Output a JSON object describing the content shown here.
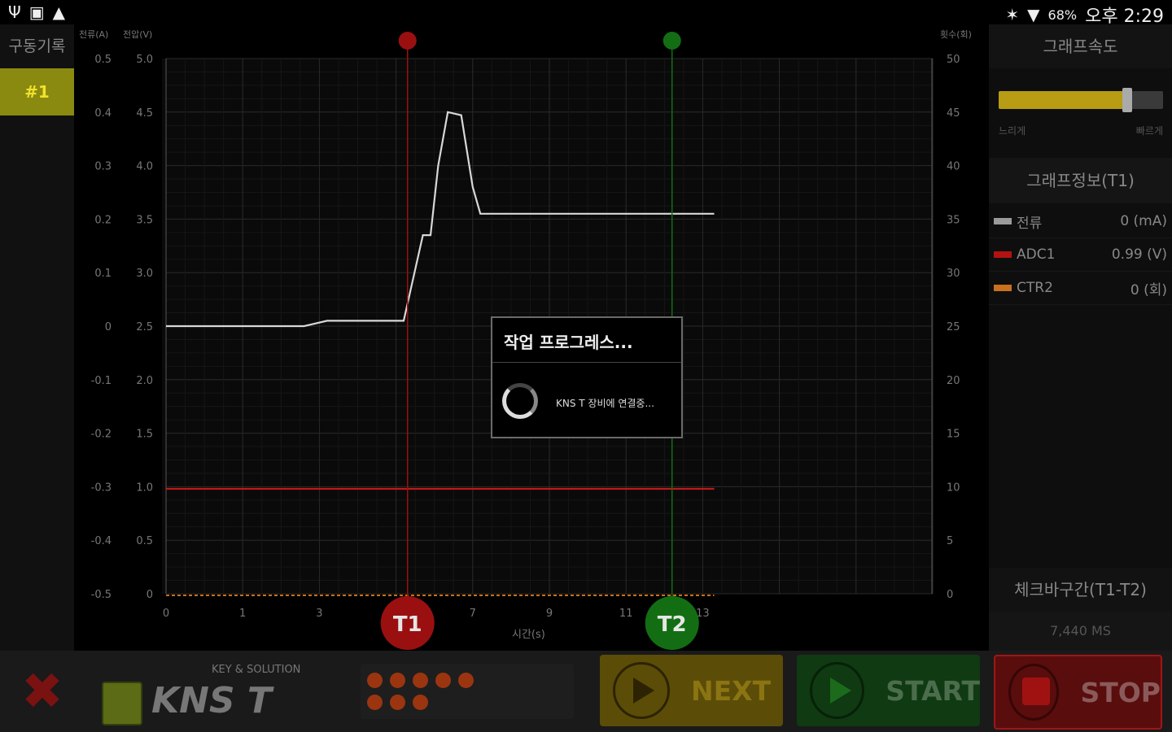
{
  "status_bar": {
    "icons_left": [
      "usb-icon",
      "image-icon",
      "warning-icon"
    ],
    "icons_right": [
      "bluetooth-icon",
      "wifi-icon"
    ],
    "battery": "68%",
    "time": "오후 2:29"
  },
  "left_panel": {
    "title": "구동기록",
    "items": [
      {
        "label": "#1"
      }
    ]
  },
  "chart_data": {
    "type": "line",
    "axis_titles": {
      "left1": "전류(A)",
      "left2": "전압(V)",
      "right": "횟수(회)",
      "x": "시간(s)"
    },
    "x_ticks": [
      "0",
      "1",
      "3",
      "5",
      "7",
      "9",
      "11",
      "13"
    ],
    "y_left1_ticks": [
      "0.5",
      "0.4",
      "0.3",
      "0.2",
      "0.1",
      "0",
      "-0.1",
      "-0.2",
      "-0.3",
      "-0.4",
      "-0.5"
    ],
    "y_left2_ticks": [
      "5.0",
      "4.5",
      "4.0",
      "3.5",
      "3.0",
      "2.5",
      "2.0",
      "1.5",
      "1.0",
      "0.5",
      "0"
    ],
    "y_right_ticks": [
      "50",
      "45",
      "40",
      "35",
      "30",
      "25",
      "20",
      "15",
      "10",
      "5",
      "0"
    ],
    "voltage_ylim": [
      0,
      5.0
    ],
    "series": [
      {
        "name": "ADC1",
        "color": "#d8d8d8",
        "axis": "voltage",
        "points": [
          [
            0,
            2.5
          ],
          [
            3.6,
            2.5
          ],
          [
            4.2,
            2.55
          ],
          [
            5,
            2.55
          ],
          [
            6.2,
            2.55
          ],
          [
            6.7,
            3.35
          ],
          [
            6.9,
            3.35
          ],
          [
            7.1,
            4.0
          ],
          [
            7.35,
            4.5
          ],
          [
            7.7,
            4.47
          ],
          [
            8.0,
            3.8
          ],
          [
            8.2,
            3.55
          ],
          [
            14.3,
            3.55
          ]
        ]
      },
      {
        "name": "",
        "color": "#c01818",
        "axis": "voltage",
        "points": [
          [
            0,
            0.98
          ],
          [
            14.3,
            0.98
          ]
        ]
      },
      {
        "name": "CTR2",
        "color": "#c8701e",
        "axis": "count",
        "points": [
          [
            0,
            0
          ],
          [
            14.3,
            0
          ]
        ]
      }
    ],
    "markers": [
      {
        "label": "T1",
        "x": 6.3,
        "color": "#9a1010"
      },
      {
        "label": "T2",
        "x": 13.2,
        "color": "#136e13"
      }
    ],
    "grid": true
  },
  "dialog": {
    "title": "작업 프로그레스...",
    "message": "KNS T 장비에 연결중..."
  },
  "right_panel": {
    "speed_title": "그래프속도",
    "slider_min_label": "느리게",
    "slider_max_label": "빠르게",
    "slider_value": 0.76,
    "info_title": "그래프정보(T1)",
    "legend": [
      {
        "name": "전류",
        "value": "0 (mA)",
        "color": "#9a9a9a"
      },
      {
        "name": "ADC1",
        "value": "0.99 (V)",
        "color": "#b31212"
      },
      {
        "name": "CTR2",
        "value": "0 (회)",
        "color": "#c8701e"
      }
    ],
    "check_title": "체크바구간(T1-T2)",
    "check_value": "7,440 MS"
  },
  "bottom_bar": {
    "logo_tag": "KEY & SOLUTION",
    "logo_name": "KNS T",
    "next_label": "NEXT",
    "start_label": "START",
    "stop_label": "STOP"
  }
}
